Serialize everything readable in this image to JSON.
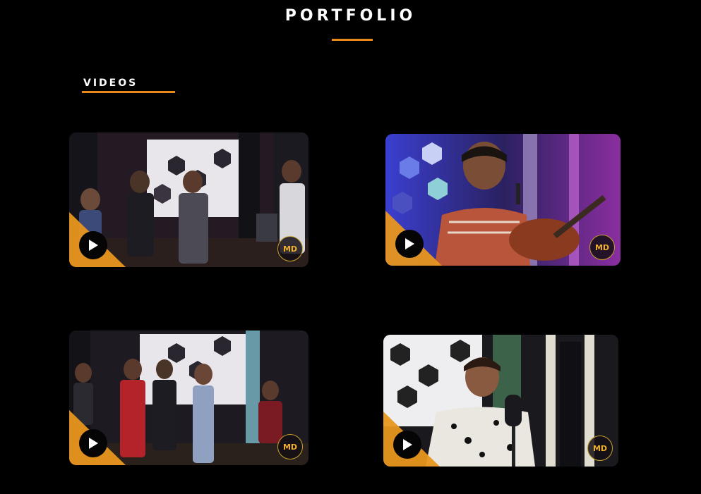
{
  "page": {
    "title": "PORTFOLIO",
    "section_label": "VIDEOS"
  },
  "colors": {
    "background": "#000000",
    "accent": "#e8891b",
    "play_corner": "#e8961e"
  },
  "videos": [
    {
      "thumbnail_desc": "band performing in studio with hexagon wall",
      "icon": "play-icon",
      "badge": "MD"
    },
    {
      "thumbnail_desc": "singer with acoustic guitar in purple-lit studio",
      "icon": "play-icon",
      "badge": "MD"
    },
    {
      "thumbnail_desc": "band with two vocalists in studio",
      "icon": "play-icon",
      "badge": "MD"
    },
    {
      "thumbnail_desc": "singer at microphone in studio",
      "icon": "play-icon",
      "badge": "MD"
    }
  ]
}
